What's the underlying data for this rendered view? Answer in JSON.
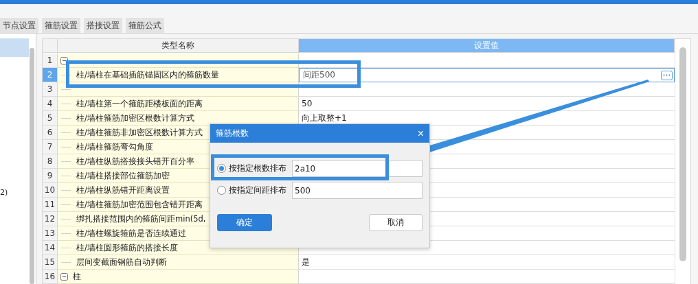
{
  "tabs": [
    {
      "label": "节点设置",
      "selected": false
    },
    {
      "label": "箍筋设置",
      "selected": false
    },
    {
      "label": "搭接设置",
      "selected": false
    },
    {
      "label": "箍筋公式",
      "selected": false
    }
  ],
  "left_panel": {
    "text_fragment": "2)"
  },
  "table": {
    "columns": [
      "类型名称",
      "设置值"
    ],
    "rows": [
      {
        "number": "1",
        "kind": "group",
        "expanded": true,
        "selected": false
      },
      {
        "number": "2",
        "kind": "item",
        "name": "柱/墙柱在基础插筋锚固区内的箍筋数量",
        "value": "间距500",
        "selected": true,
        "editing": true
      },
      {
        "number": "3",
        "kind": "item",
        "selected": false
      },
      {
        "number": "4",
        "kind": "item",
        "name": "柱/墙柱第一个箍筋距楼板面的距离",
        "value": "50",
        "selected": false
      },
      {
        "number": "5",
        "kind": "item",
        "name": "柱/墙柱箍筋加密区根数计算方式",
        "value": "向上取整+1",
        "selected": false
      },
      {
        "number": "6",
        "kind": "item",
        "name": "柱/墙柱箍筋非加密区根数计算方式",
        "selected": false
      },
      {
        "number": "7",
        "kind": "item",
        "name": "柱/墙柱箍筋弯勾角度",
        "selected": false
      },
      {
        "number": "8",
        "kind": "item",
        "name": "柱/墙柱纵筋搭接接头错开百分率",
        "selected": false
      },
      {
        "number": "9",
        "kind": "item",
        "name": "柱/墙柱搭接部位箍筋加密",
        "selected": false
      },
      {
        "number": "10",
        "kind": "item",
        "name": "柱/墙柱纵筋错开距离设置",
        "selected": false
      },
      {
        "number": "11",
        "kind": "item",
        "name": "柱/墙柱箍筋加密范围包含错开距离",
        "selected": false
      },
      {
        "number": "12",
        "kind": "item",
        "name": "绑扎搭接范围内的箍筋间距min(5d,",
        "selected": false
      },
      {
        "number": "13",
        "kind": "item",
        "name": "柱/墙柱螺旋箍筋是否连续通过",
        "selected": false
      },
      {
        "number": "14",
        "kind": "item",
        "name": "柱/墙柱圆形箍筋的搭接长度",
        "selected": false
      },
      {
        "number": "15",
        "kind": "item",
        "name": "层间变截面钢筋自动判断",
        "value": "是",
        "selected": false
      },
      {
        "number": "16",
        "kind": "group",
        "name": "柱",
        "expanded": true,
        "selected": false
      }
    ]
  },
  "dialog": {
    "title": "箍筋根数",
    "close": "×",
    "options": [
      {
        "label": "按指定根数排布",
        "selected": true,
        "value": "2a10"
      },
      {
        "label": "按指定间距排布",
        "selected": false,
        "value": "500"
      }
    ],
    "buttons": [
      {
        "label": "确定",
        "kind": "primary"
      },
      {
        "label": "取消",
        "kind": "secondary"
      }
    ]
  }
}
